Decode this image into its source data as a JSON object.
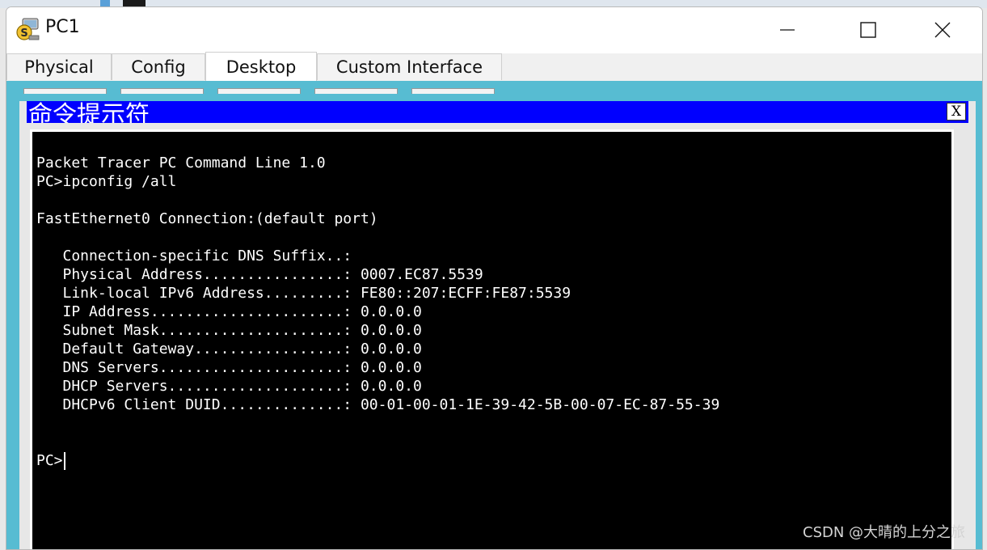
{
  "window": {
    "title": "PC1"
  },
  "tabs": [
    {
      "label": "Physical",
      "active": false
    },
    {
      "label": "Config",
      "active": false
    },
    {
      "label": "Desktop",
      "active": true
    },
    {
      "label": "Custom Interface",
      "active": false
    }
  ],
  "cmd": {
    "title": "命令提示符",
    "close_label": "X",
    "lines": [
      "Packet Tracer PC Command Line 1.0",
      "PC>ipconfig /all",
      "",
      "FastEthernet0 Connection:(default port)",
      "",
      "   Connection-specific DNS Suffix..: ",
      "   Physical Address................: 0007.EC87.5539",
      "   Link-local IPv6 Address.........: FE80::207:ECFF:FE87:5539",
      "   IP Address......................: 0.0.0.0",
      "   Subnet Mask.....................: 0.0.0.0",
      "   Default Gateway.................: 0.0.0.0",
      "   DNS Servers.....................: 0.0.0.0",
      "   DHCP Servers....................: 0.0.0.0",
      "   DHCPv6 Client DUID..............: 00-01-00-01-1E-39-42-5B-00-07-EC-87-55-39",
      "",
      ""
    ],
    "prompt": "PC>"
  },
  "watermark": "CSDN @大晴的上分之旅",
  "colors": {
    "content_bg": "#57bcd2",
    "cmd_titlebar": "#0000ff",
    "terminal_bg": "#000000",
    "terminal_fg": "#ffffff"
  },
  "icons": {
    "app": "packet-tracer-pc-icon",
    "minimize": "minimize-icon",
    "maximize": "maximize-icon",
    "close": "close-icon"
  }
}
